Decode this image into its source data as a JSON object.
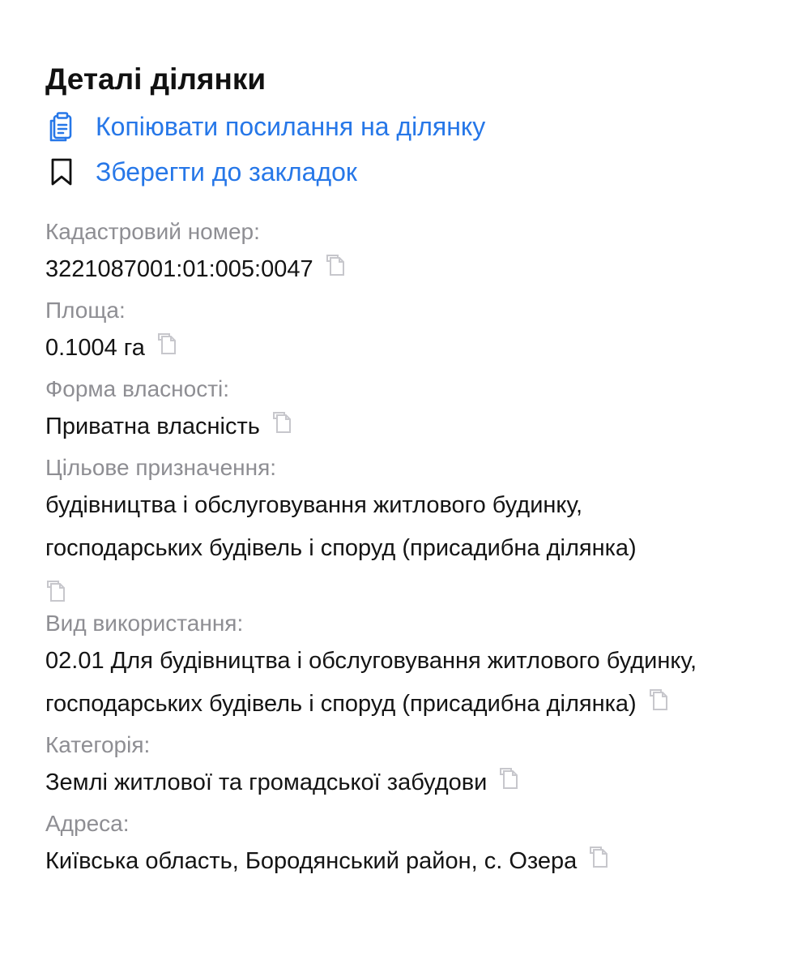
{
  "page": {
    "title": "Деталі ділянки"
  },
  "actions": {
    "copy_link_label": "Копіювати посилання на ділянку",
    "bookmark_label": "Зберегти до закладок"
  },
  "fields": {
    "cadastral": {
      "label": "Кадастровий номер:",
      "value": "3221087001:01:005:0047"
    },
    "area": {
      "label": "Площа:",
      "value": "0.1004 га"
    },
    "ownership": {
      "label": "Форма власності:",
      "value": "Приватна власність"
    },
    "purpose": {
      "label": "Цільове призначення:",
      "value": "будівництва і обслуговування житлового будинку, господарських будівель і споруд (присадибна ділянка)"
    },
    "usage": {
      "label": "Вид використання:",
      "value": "02.01 Для будівництва і обслуговування житлового будинку, господарських будівель і споруд (присадибна ділянка)"
    },
    "category": {
      "label": "Категорія:",
      "value": "Землі житлової та громадської забудови"
    },
    "address": {
      "label": "Адреса:",
      "value": "Київська область, Бородянський район, с. Озера"
    }
  },
  "colors": {
    "accent": "#2677e8",
    "label_gray": "#8e8e93",
    "text": "#141414",
    "copy_icon": "#c7c7cc"
  },
  "icons": {
    "copy_link": "clipboard-icon",
    "bookmark": "bookmark-icon",
    "copy_value": "copy-icon"
  }
}
